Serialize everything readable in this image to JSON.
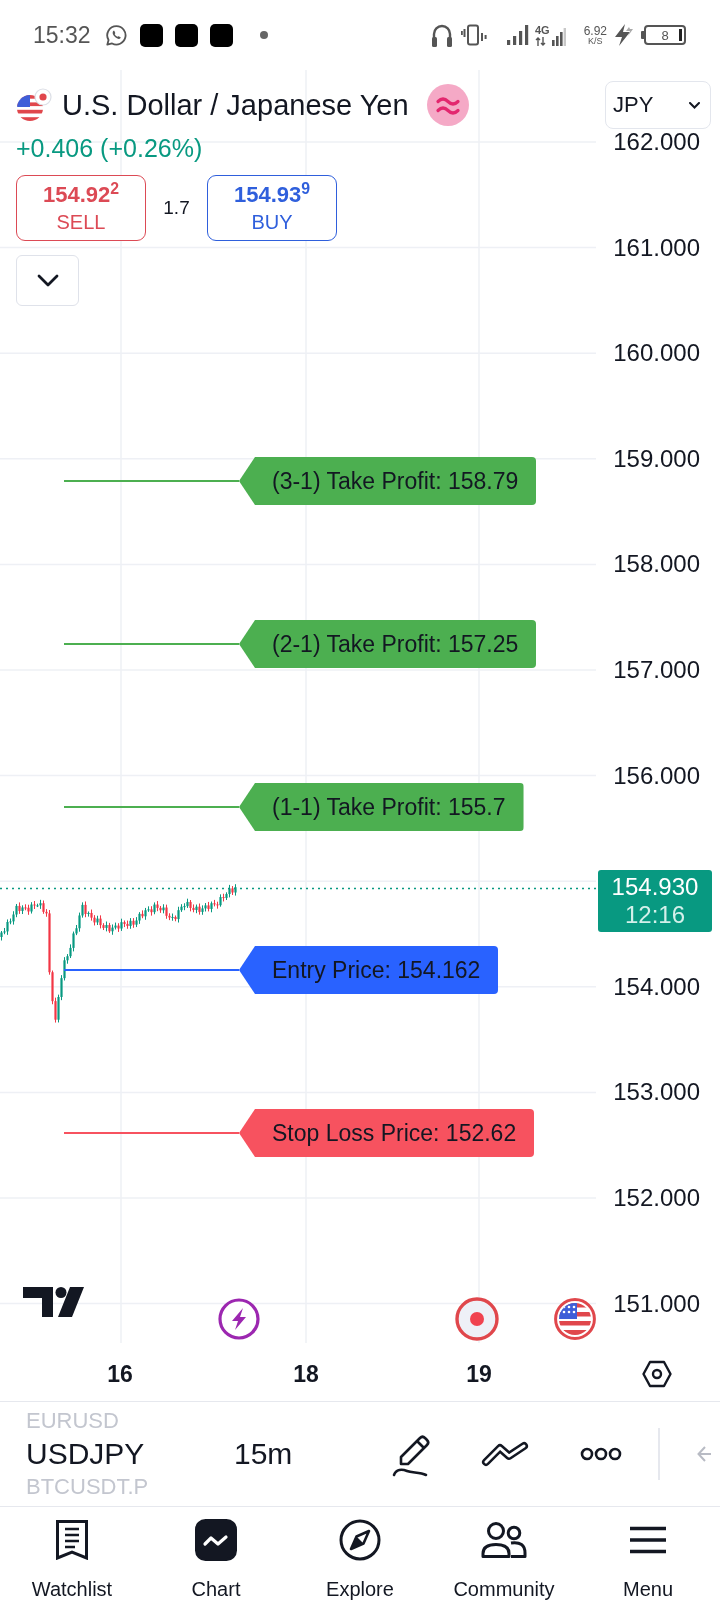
{
  "status_bar": {
    "time": "15:32",
    "network_type": "4G",
    "data_speed": "6.92",
    "data_speed_unit": "K/S",
    "battery": "8"
  },
  "header": {
    "title": "U.S. Dollar / Japanese Yen",
    "change": "+0.406 (+0.26%)",
    "currency_selector": "JPY",
    "sell": {
      "price": "154.92$^{2}$",
      "label": "SELL"
    },
    "spread": "1.7",
    "buy": {
      "price": "154.93$^{9}$",
      "label": "BUY"
    }
  },
  "price_axis": [
    "162.000",
    "161.000",
    "160.000",
    "159.000",
    "158.000",
    "157.000",
    "156.000",
    "154.000",
    "153.000",
    "152.000",
    "151.000"
  ],
  "current_price": {
    "price": "154.930",
    "countdown": "12:16"
  },
  "orders": [
    {
      "label": "(3-1) Take Profit: 158.79",
      "color": "#4caf50"
    },
    {
      "label": "(2-1) Take Profit: 157.25",
      "color": "#4caf50"
    },
    {
      "label": "(1-1) Take Profit: 155.7",
      "color": "#4caf50"
    },
    {
      "label": "Entry Price: 154.162",
      "color": "#2962ff"
    },
    {
      "label": "Stop Loss Price: 152.62",
      "color": "#f7525f"
    }
  ],
  "time_axis": [
    "16",
    "18",
    "19"
  ],
  "toolbar": {
    "symbols": [
      {
        "label": "EURUSD",
        "selected": false
      },
      {
        "label": "USDJPY",
        "selected": true
      },
      {
        "label": "BTCUSDT.P",
        "selected": false
      }
    ],
    "interval": "15m"
  },
  "bottom_nav": [
    {
      "label": "Watchlist",
      "kind": "watchlist",
      "selected": false
    },
    {
      "label": "Chart",
      "kind": "chart",
      "selected": true
    },
    {
      "label": "Explore",
      "kind": "explore",
      "selected": false
    },
    {
      "label": "Community",
      "kind": "community",
      "selected": false
    },
    {
      "label": "Menu",
      "kind": "menu",
      "selected": false
    }
  ]
}
